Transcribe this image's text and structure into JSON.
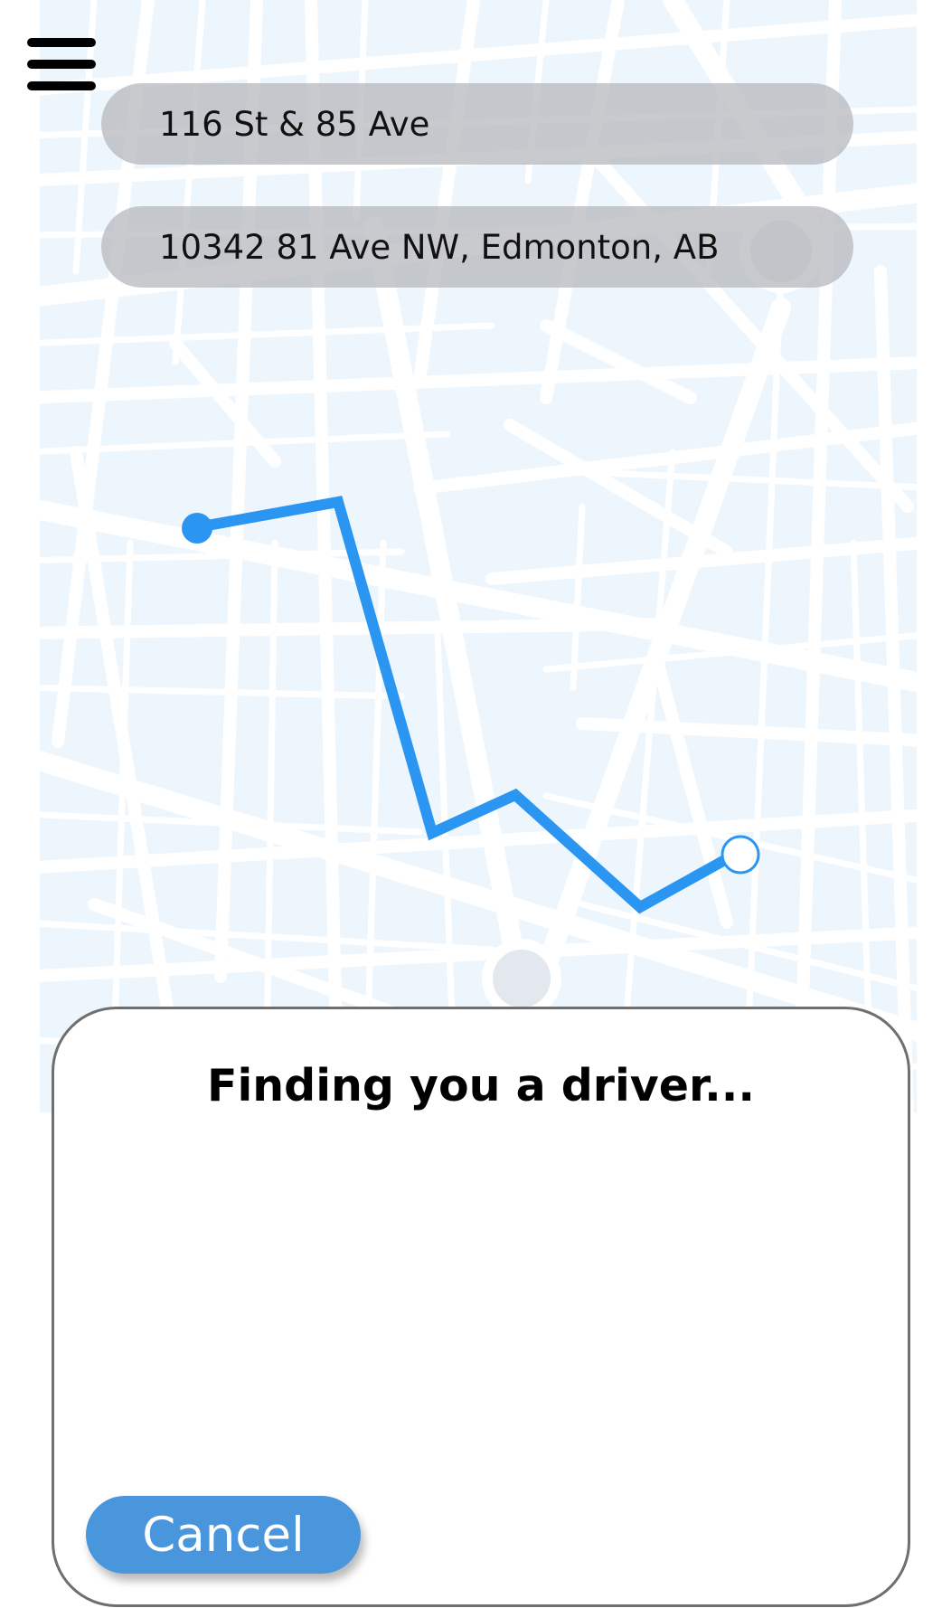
{
  "menu": {
    "icon": "hamburger-menu-icon"
  },
  "pickup": {
    "value": "116 St & 85 Ave"
  },
  "dropoff": {
    "value": "10342 81 Ave NW, Edmonton, AB"
  },
  "map": {
    "background_color": "#eef6fd",
    "road_color": "#ffffff",
    "route_color": "#2a96f2",
    "start_marker": "route-start-dot",
    "end_marker": "route-end-circle"
  },
  "status_panel": {
    "title": "Finding you a driver...",
    "cancel_label": "Cancel",
    "cancel_color": "#4a96dc"
  }
}
